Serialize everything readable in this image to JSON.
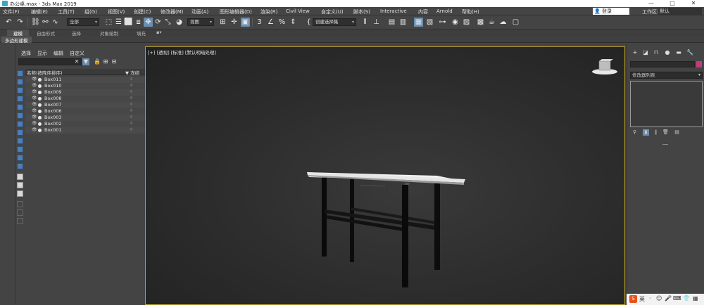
{
  "window": {
    "title": "办公桌.max - 3ds Max 2019",
    "controls": [
      "—",
      "□",
      "✕"
    ]
  },
  "menu": {
    "items": [
      "文件(F)",
      "编辑(E)",
      "工具(T)",
      "组(G)",
      "视图(V)",
      "创建(C)",
      "修改器(M)",
      "动画(A)",
      "图形编辑器(D)",
      "渲染(R)",
      "Civil View",
      "自定义(U)",
      "脚本(S)",
      "Interactive",
      "内容",
      "Arnold",
      "帮助(H)"
    ],
    "signin_label": "登录",
    "workspace_label": "工作区:",
    "workspace_value": "默认"
  },
  "toolbar": {
    "selection_filter": "全部",
    "reference_coord": "视图",
    "named_selection": "创建选择集"
  },
  "ribbon": {
    "tabs": [
      "建模",
      "自由形式",
      "选择",
      "对象绘制",
      "填充"
    ],
    "active_tab": "建模",
    "subtab": "多边形建模"
  },
  "scene_explorer": {
    "menu": [
      "选择",
      "显示",
      "编辑",
      "自定义"
    ],
    "col_name": "名称(按降序排序)",
    "col_freeze": "▼ 冻结",
    "objects": [
      "Box011",
      "Box010",
      "Box009",
      "Box008",
      "Box007",
      "Box006",
      "Box003",
      "Box002",
      "Box001"
    ]
  },
  "viewport": {
    "label": "[+] [透视] [标准] [默认明暗处理]"
  },
  "command_panel": {
    "modifier_list": "修改器列表"
  },
  "taskbar": {
    "ime": "英"
  },
  "colors": {
    "accent": "#6a8fb0",
    "viewport_border": "#b79b2c",
    "object_color": "#c43a7e"
  }
}
